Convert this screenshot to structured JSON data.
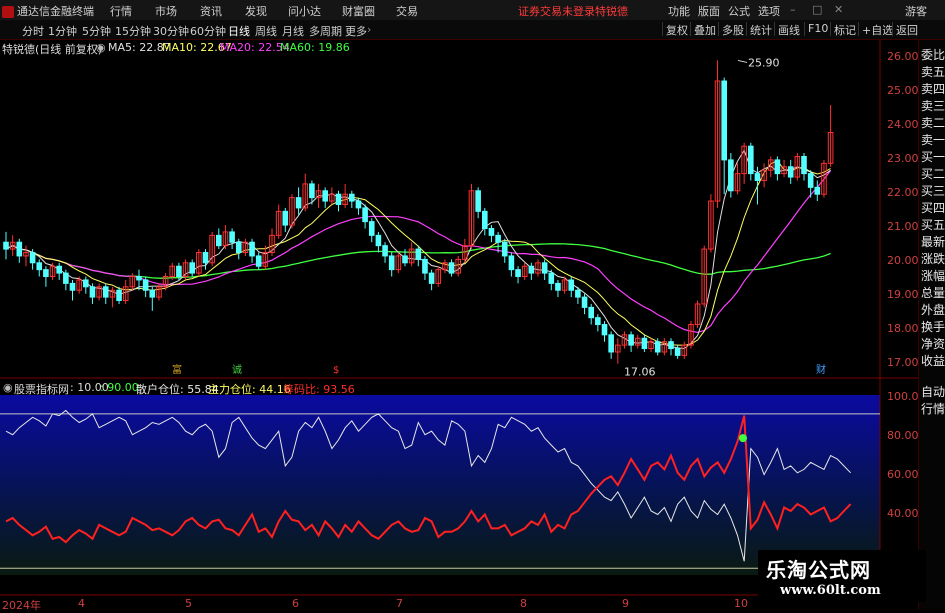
{
  "menu": {
    "brand": "通达信金融终端",
    "items": [
      "行情",
      "市场",
      "资讯",
      "发现",
      "问小达",
      "财富圈",
      "交易"
    ],
    "notice": "证券交易未登录",
    "account": "特锐德",
    "right_items": [
      "功能",
      "版面",
      "公式",
      "选项"
    ],
    "guest": "游客"
  },
  "toolbar": {
    "periods": [
      "分时",
      "1分钟",
      "5分钟",
      "15分钟",
      "30分钟",
      "60分钟",
      "日线",
      "周线",
      "月线",
      "多周期",
      "更多"
    ],
    "active_period": "日线",
    "right_buttons": [
      "复权",
      "叠加",
      "多股",
      "统计",
      "画线",
      "F10",
      "标记",
      "+自选",
      "返回"
    ]
  },
  "info": {
    "stock_title": "特锐德(日线 前复权)",
    "ma5": "MA5: 22.87",
    "ma10": "MA10: 22.67",
    "ma20": "MA20: 22.54",
    "ma60": "MA60: 19.86"
  },
  "price_axis": [
    "26.00",
    "25.00",
    "24.00",
    "23.00",
    "22.00",
    "21.00",
    "20.00",
    "19.00",
    "18.00",
    "17.00"
  ],
  "annotations": {
    "high": "25.90",
    "low": "17.06"
  },
  "event_markers": [
    "富",
    "诚",
    "$",
    "财"
  ],
  "indicator": {
    "name": "股票指标网",
    "v1": ": 10.00",
    "v2": ": 90.00",
    "retail_label": "散户仓位: 55.84",
    "main_label": "主力仓位: 44.16",
    "ratio_label": "筹码比: 93.56"
  },
  "indicator_axis": [
    "100.0",
    "80.00",
    "60.00",
    "40.00"
  ],
  "x_axis": [
    "2024年",
    "4",
    "5",
    "6",
    "7",
    "8",
    "9",
    "10"
  ],
  "sidebar": [
    "委比",
    "卖五",
    "卖四",
    "卖三",
    "卖二",
    "卖一",
    "买一",
    "买二",
    "买三",
    "买四",
    "买五",
    "最新",
    "涨跌",
    "涨幅",
    "总量",
    "外盘",
    "换手",
    "净资",
    "收益",
    "自动",
    "行情"
  ],
  "watermark": {
    "title": "乐淘公式网",
    "url": "www.60lt.com"
  },
  "colors": {
    "up": "#ff3030",
    "down": "#54ffff",
    "ma5": "#e0e0e0",
    "ma10": "#ffff60",
    "ma20": "#ff40ff",
    "ma60": "#40ff40",
    "retail_line": "#e8e8e8",
    "main_line": "#ff2020"
  },
  "chart_data": {
    "type": "line",
    "price_range": [
      17.06,
      25.9
    ],
    "indicator_range": [
      0,
      100
    ],
    "candles": [
      [
        20.6,
        20.4,
        20.9,
        20.1
      ],
      [
        20.4,
        20.6,
        20.8,
        20.2
      ],
      [
        20.6,
        20.2,
        20.7,
        20.0
      ],
      [
        20.2,
        20.3,
        20.5,
        19.9
      ],
      [
        20.3,
        20.0,
        20.4,
        19.8
      ],
      [
        20.0,
        19.8,
        20.1,
        19.6
      ],
      [
        19.8,
        19.6,
        19.9,
        19.3
      ],
      [
        19.6,
        19.9,
        20.0,
        19.5
      ],
      [
        19.9,
        19.7,
        20.0,
        19.5
      ],
      [
        19.7,
        19.4,
        19.8,
        19.2
      ],
      [
        19.4,
        19.2,
        19.5,
        18.9
      ],
      [
        19.2,
        19.5,
        19.6,
        19.1
      ],
      [
        19.5,
        19.3,
        19.6,
        19.1
      ],
      [
        19.3,
        19.0,
        19.4,
        18.8
      ],
      [
        19.0,
        19.3,
        19.4,
        18.9
      ],
      [
        19.3,
        19.0,
        19.4,
        18.8
      ],
      [
        19.0,
        19.2,
        19.3,
        18.7
      ],
      [
        19.2,
        18.9,
        19.3,
        18.8
      ],
      [
        18.9,
        19.3,
        19.5,
        18.8
      ],
      [
        19.3,
        19.6,
        19.7,
        19.2
      ],
      [
        19.6,
        19.5,
        19.8,
        19.2
      ],
      [
        19.5,
        19.2,
        19.6,
        19.0
      ],
      [
        19.2,
        19.0,
        19.3,
        18.6
      ],
      [
        19.0,
        19.3,
        19.4,
        18.9
      ],
      [
        19.3,
        19.6,
        19.7,
        19.2
      ],
      [
        19.6,
        19.9,
        20.0,
        19.5
      ],
      [
        19.9,
        19.6,
        20.0,
        19.5
      ],
      [
        19.6,
        20.0,
        20.1,
        19.5
      ],
      [
        20.0,
        19.7,
        20.1,
        19.6
      ],
      [
        19.7,
        20.3,
        20.4,
        19.6
      ],
      [
        20.3,
        20.0,
        20.4,
        19.8
      ],
      [
        20.0,
        20.8,
        20.9,
        19.9
      ],
      [
        20.8,
        20.5,
        21.0,
        20.4
      ],
      [
        20.5,
        20.9,
        21.1,
        20.4
      ],
      [
        20.9,
        20.6,
        21.0,
        20.4
      ],
      [
        20.6,
        20.3,
        20.7,
        20.1
      ],
      [
        20.3,
        20.6,
        20.7,
        20.2
      ],
      [
        20.6,
        20.2,
        20.7,
        20.0
      ],
      [
        20.2,
        19.9,
        20.3,
        19.8
      ],
      [
        19.9,
        20.3,
        20.5,
        19.8
      ],
      [
        20.3,
        20.8,
        21.0,
        20.2
      ],
      [
        20.8,
        21.5,
        21.7,
        20.7
      ],
      [
        21.5,
        21.1,
        21.6,
        20.9
      ],
      [
        21.1,
        21.9,
        22.0,
        21.0
      ],
      [
        21.9,
        21.6,
        22.2,
        21.4
      ],
      [
        21.6,
        22.3,
        22.6,
        21.5
      ],
      [
        22.3,
        21.9,
        22.4,
        21.7
      ],
      [
        21.9,
        22.1,
        22.3,
        21.6
      ],
      [
        22.1,
        21.8,
        22.2,
        21.6
      ],
      [
        21.8,
        22.0,
        22.2,
        21.7
      ],
      [
        22.0,
        21.7,
        22.1,
        21.5
      ],
      [
        21.7,
        22.0,
        22.3,
        21.6
      ],
      [
        22.0,
        21.8,
        22.1,
        21.6
      ],
      [
        21.8,
        21.6,
        21.9,
        21.4
      ],
      [
        21.6,
        21.2,
        21.7,
        21.0
      ],
      [
        21.2,
        20.8,
        21.3,
        20.6
      ],
      [
        20.8,
        20.5,
        20.9,
        20.3
      ],
      [
        20.5,
        20.2,
        20.6,
        20.0
      ],
      [
        20.2,
        19.8,
        20.3,
        19.6
      ],
      [
        19.8,
        20.2,
        20.3,
        19.7
      ],
      [
        20.2,
        20.0,
        20.4,
        19.9
      ],
      [
        20.0,
        20.4,
        20.6,
        19.9
      ],
      [
        20.4,
        20.1,
        20.5,
        19.9
      ],
      [
        20.1,
        19.7,
        20.2,
        19.5
      ],
      [
        19.7,
        19.4,
        19.8,
        19.2
      ],
      [
        19.4,
        19.8,
        19.9,
        19.3
      ],
      [
        19.8,
        20.0,
        20.1,
        19.7
      ],
      [
        20.0,
        19.7,
        20.1,
        19.6
      ],
      [
        19.7,
        20.1,
        20.2,
        19.6
      ],
      [
        20.1,
        20.5,
        20.7,
        20.0
      ],
      [
        20.5,
        22.1,
        22.3,
        20.4
      ],
      [
        22.1,
        21.5,
        22.2,
        21.3
      ],
      [
        21.5,
        21.0,
        21.6,
        20.8
      ],
      [
        21.0,
        20.8,
        21.1,
        20.6
      ],
      [
        20.8,
        20.6,
        20.9,
        20.3
      ],
      [
        20.6,
        20.2,
        20.7,
        20.0
      ],
      [
        20.2,
        19.8,
        20.3,
        19.6
      ],
      [
        19.8,
        19.6,
        19.9,
        19.4
      ],
      [
        19.6,
        19.9,
        20.0,
        19.5
      ],
      [
        19.9,
        19.7,
        20.0,
        19.5
      ],
      [
        19.7,
        20.0,
        20.1,
        19.6
      ],
      [
        20.0,
        19.7,
        20.1,
        19.5
      ],
      [
        19.7,
        19.4,
        19.8,
        19.2
      ],
      [
        19.4,
        19.2,
        19.5,
        19.0
      ],
      [
        19.2,
        19.5,
        19.6,
        19.1
      ],
      [
        19.5,
        19.2,
        19.6,
        19.0
      ],
      [
        19.2,
        19.0,
        19.3,
        18.8
      ],
      [
        19.0,
        18.7,
        19.1,
        18.5
      ],
      [
        18.7,
        18.4,
        18.8,
        18.2
      ],
      [
        18.4,
        18.2,
        18.5,
        18.0
      ],
      [
        18.2,
        17.9,
        18.3,
        17.7
      ],
      [
        17.9,
        17.4,
        18.0,
        17.2
      ],
      [
        17.4,
        17.6,
        17.8,
        17.06
      ],
      [
        17.6,
        17.9,
        18.0,
        17.5
      ],
      [
        17.9,
        17.6,
        18.0,
        17.4
      ],
      [
        17.6,
        17.8,
        17.9,
        17.5
      ],
      [
        17.8,
        17.5,
        17.9,
        17.4
      ],
      [
        17.5,
        17.7,
        17.8,
        17.4
      ],
      [
        17.7,
        17.4,
        17.8,
        17.3
      ],
      [
        17.4,
        17.7,
        17.8,
        17.3
      ],
      [
        17.7,
        17.5,
        17.8,
        17.3
      ],
      [
        17.5,
        17.3,
        17.6,
        17.2
      ],
      [
        17.3,
        17.6,
        17.7,
        17.2
      ],
      [
        17.6,
        18.2,
        18.3,
        17.5
      ],
      [
        18.2,
        18.8,
        18.9,
        18.1
      ],
      [
        18.8,
        20.4,
        20.5,
        18.7
      ],
      [
        20.4,
        21.8,
        22.0,
        20.3
      ],
      [
        21.8,
        25.3,
        25.9,
        21.6
      ],
      [
        25.3,
        23.0,
        25.4,
        22.0
      ],
      [
        23.0,
        22.1,
        23.2,
        21.9
      ],
      [
        22.1,
        22.6,
        22.9,
        22.0
      ],
      [
        22.6,
        23.4,
        23.5,
        22.3
      ],
      [
        23.4,
        22.6,
        23.5,
        22.4
      ],
      [
        22.6,
        22.4,
        22.8,
        21.7
      ],
      [
        22.4,
        22.7,
        22.9,
        22.2
      ],
      [
        22.7,
        23.0,
        23.1,
        22.5
      ],
      [
        23.0,
        22.6,
        23.1,
        22.4
      ],
      [
        22.6,
        22.8,
        23.0,
        22.5
      ],
      [
        22.8,
        22.5,
        23.0,
        22.3
      ],
      [
        22.5,
        23.1,
        23.2,
        22.4
      ],
      [
        23.1,
        22.6,
        23.2,
        22.4
      ],
      [
        22.6,
        22.2,
        22.7,
        21.9
      ],
      [
        22.2,
        22.0,
        22.4,
        21.8
      ],
      [
        22.0,
        22.9,
        23.0,
        21.9
      ],
      [
        22.9,
        23.8,
        24.6,
        22.8
      ]
    ],
    "retail_series": [
      80,
      78,
      82,
      85,
      88,
      86,
      83,
      90,
      89,
      92,
      88,
      85,
      87,
      90,
      82,
      84,
      86,
      88,
      86,
      78,
      80,
      82,
      85,
      84,
      86,
      88,
      85,
      80,
      78,
      82,
      84,
      80,
      65,
      70,
      85,
      88,
      82,
      76,
      72,
      70,
      75,
      80,
      60,
      65,
      80,
      85,
      82,
      88,
      80,
      70,
      75,
      82,
      86,
      80,
      84,
      88,
      90,
      86,
      82,
      80,
      70,
      72,
      85,
      78,
      80,
      75,
      72,
      86,
      84,
      80,
      60,
      66,
      62,
      70,
      84,
      82,
      88,
      86,
      84,
      80,
      82,
      76,
      72,
      68,
      70,
      62,
      60,
      55,
      50,
      46,
      42,
      40,
      45,
      38,
      30,
      36,
      42,
      34,
      32,
      36,
      28,
      38,
      42,
      34,
      30,
      40,
      35,
      32,
      38,
      30,
      20,
      5,
      70,
      65,
      55,
      62,
      70,
      58,
      60,
      56,
      58,
      62,
      60,
      58,
      66,
      64,
      60,
      56
    ]
  }
}
